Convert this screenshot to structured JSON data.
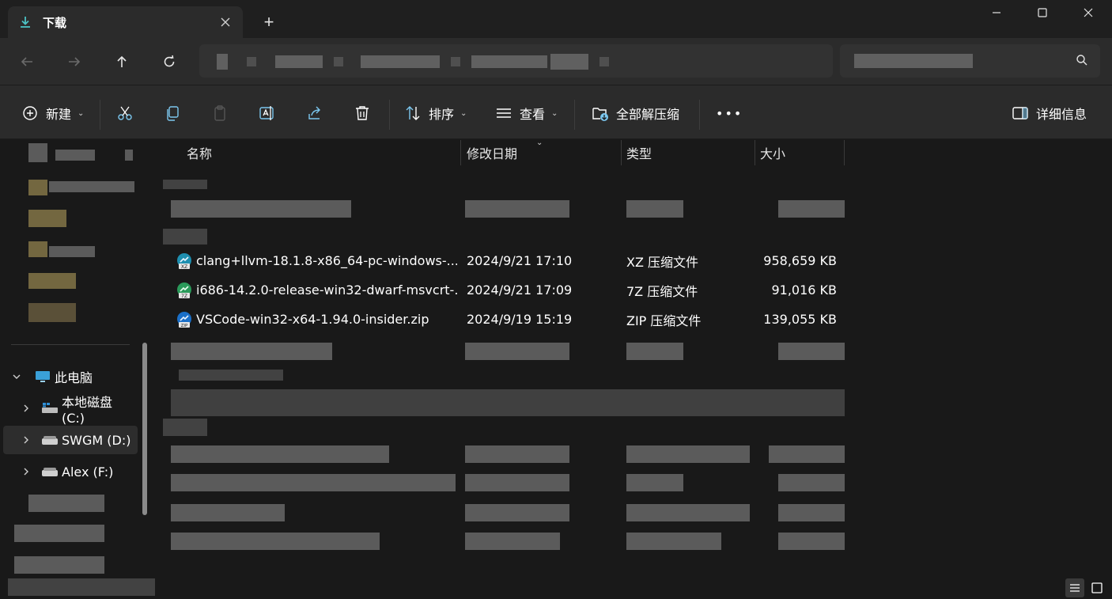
{
  "window": {
    "tab_title": "下载",
    "tab_icon": "download-icon",
    "new_tab_label": "+"
  },
  "toolbar": {
    "new_label": "新建",
    "sort_label": "排序",
    "view_label": "查看",
    "extract_label": "全部解压缩",
    "more_label": "•••",
    "details_label": "详细信息"
  },
  "sidebar": {
    "this_pc": "此电脑",
    "drives": [
      {
        "label": "本地磁盘 (C:)",
        "icon": "local-disk-icon"
      },
      {
        "label": "SWGM (D:)",
        "icon": "drive-icon"
      },
      {
        "label": "Alex (F:)",
        "icon": "drive-icon"
      }
    ]
  },
  "columns": {
    "name": "名称",
    "date": "修改日期",
    "type": "类型",
    "size": "大小"
  },
  "files": [
    {
      "name": "clang+llvm-18.1.8-x86_64-pc-windows-...",
      "date": "2024/9/21 17:10",
      "type": "XZ 压缩文件",
      "size": "958,659 KB",
      "icon_text": "XZ"
    },
    {
      "name": "i686-14.2.0-release-win32-dwarf-msvcrt-...",
      "date": "2024/9/21 17:09",
      "type": "7Z 压缩文件",
      "size": "91,016 KB",
      "icon_text": "7Z"
    },
    {
      "name": "VSCode-win32-x64-1.94.0-insider.zip",
      "date": "2024/9/19 15:19",
      "type": "ZIP 压缩文件",
      "size": "139,055 KB",
      "icon_text": "ZIP"
    }
  ],
  "colors": {
    "accent": "#4cc2c4",
    "background": "#191919",
    "toolbar": "#2b2b2b"
  }
}
